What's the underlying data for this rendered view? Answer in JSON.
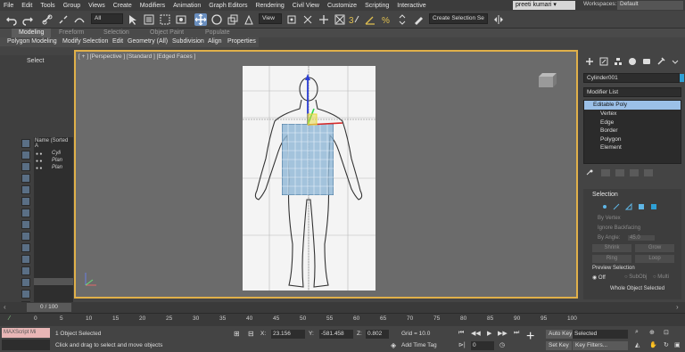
{
  "menu": [
    "File",
    "Edit",
    "Tools",
    "Group",
    "Views",
    "Create",
    "Modifiers",
    "Animation",
    "Graph Editors",
    "Rendering",
    "Civil View",
    "Customize",
    "Scripting",
    "Interactive"
  ],
  "user": "preeti kumari",
  "workspaces_label": "Workspaces:",
  "workspaces_value": "Default",
  "toolbar": {
    "filter_value": "All",
    "view_value": "View",
    "selection_set": "Create Selection Se"
  },
  "ribbon_tabs": [
    "Modeling",
    "Freeform",
    "Selection",
    "Object Paint",
    "Populate"
  ],
  "ribbon_sub": [
    "Polygon Modeling",
    "Modify Selection",
    "Edit",
    "Geometry (All)",
    "Subdivision",
    "Align",
    "Properties"
  ],
  "explorer": {
    "title": "Select",
    "header": "Name (Sorted A",
    "items": [
      "Cyli",
      "Plan",
      "Plan"
    ]
  },
  "viewport": {
    "label": "[ + ] [Perspective ] [Standard ] [Edged Faces ]"
  },
  "command_panel": {
    "object_name": "Cylinder001",
    "modifier_list": "Modifier List",
    "stack_selected": "Editable Poly",
    "stack_subs": [
      "Vertex",
      "Edge",
      "Border",
      "Polygon",
      "Element"
    ],
    "selection_title": "Selection",
    "by_vertex": "By Vertex",
    "ignore_backfacing": "Ignore Backfacing",
    "by_angle": "By Angle:",
    "by_angle_value": "45.0",
    "shrink": "Shrink",
    "grow": "Grow",
    "ring": "Ring",
    "loop": "Loop",
    "preview_selection": "Preview Selection",
    "preview_off": "Off",
    "preview_subobj": "SubObj",
    "preview_multi": "Multi",
    "whole_object": "Whole Object Selected"
  },
  "timeline": {
    "thumb": "0 / 100",
    "ticks": [
      "0",
      "5",
      "10",
      "15",
      "20",
      "25",
      "30",
      "35",
      "40",
      "45",
      "50",
      "55",
      "60",
      "65",
      "70",
      "75",
      "80",
      "85",
      "90",
      "95",
      "100"
    ]
  },
  "status": {
    "maxscript": "MAXScript Mi",
    "selected": "1 Object Selected",
    "prompt": "Click and drag to select and move objects",
    "x_label": "X:",
    "x_value": "23.156",
    "y_label": "Y:",
    "y_value": "-581.458",
    "z_label": "Z:",
    "z_value": "0.802",
    "grid": "Grid = 10.0",
    "add_time_tag": "Add Time Tag",
    "frame": "0",
    "auto_key": "Auto Key",
    "set_key": "Set Key",
    "selected_dd": "Selected",
    "key_filters": "Key Filters..."
  }
}
